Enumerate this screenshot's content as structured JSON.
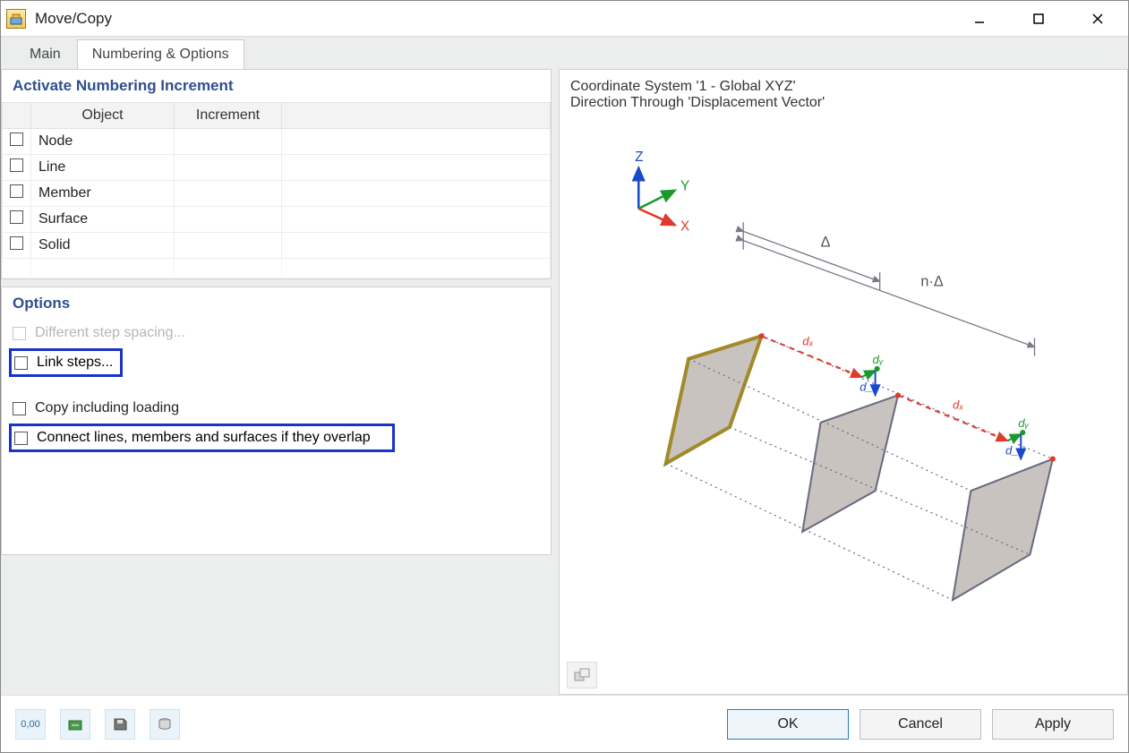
{
  "window": {
    "title": "Move/Copy"
  },
  "tabs": [
    {
      "label": "Main",
      "active": false
    },
    {
      "label": "Numbering & Options",
      "active": true
    }
  ],
  "section_numbering": {
    "title": "Activate Numbering Increment",
    "columns": [
      "Object",
      "Increment"
    ],
    "rows": [
      {
        "object": "Node",
        "increment": ""
      },
      {
        "object": "Line",
        "increment": ""
      },
      {
        "object": "Member",
        "increment": ""
      },
      {
        "object": "Surface",
        "increment": ""
      },
      {
        "object": "Solid",
        "increment": ""
      }
    ]
  },
  "section_options": {
    "title": "Options",
    "items": {
      "different_step": "Different step spacing...",
      "link_steps": "Link steps...",
      "copy_loading": "Copy including loading",
      "connect_overlap": "Connect lines, members and surfaces if they overlap"
    }
  },
  "preview": {
    "line1": "Coordinate System '1 - Global XYZ'",
    "line2": "Direction Through 'Displacement Vector'",
    "axes": {
      "x": "X",
      "y": "Y",
      "z": "Z"
    },
    "labels": {
      "delta": "Δ",
      "ndelta": "n·Δ",
      "dx": "dₓ",
      "dy": "dᵧ",
      "dz": "d_z"
    }
  },
  "footer": {
    "ok": "OK",
    "cancel": "Cancel",
    "apply": "Apply",
    "icon_decimal": "0,00"
  }
}
